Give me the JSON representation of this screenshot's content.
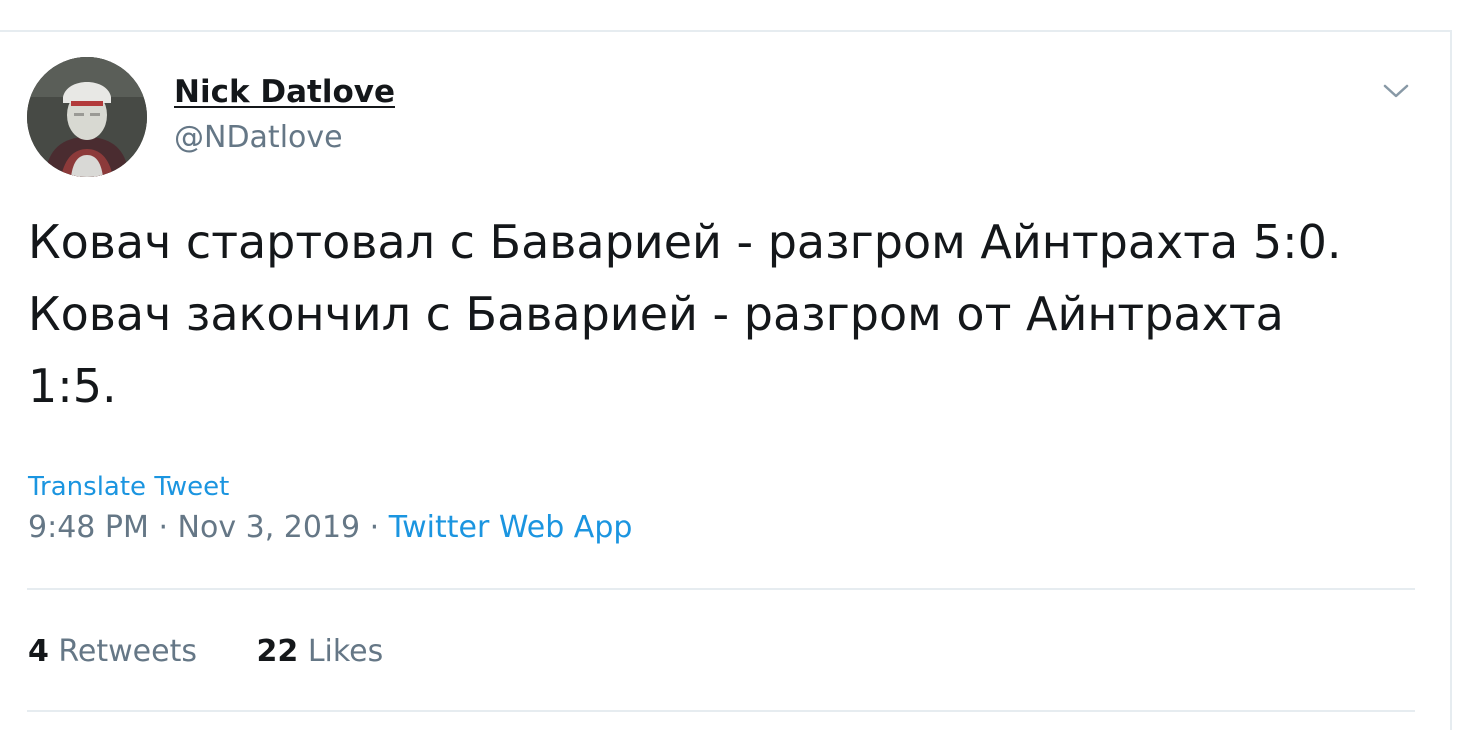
{
  "tweet": {
    "author": {
      "display_name": "Nick Datlove",
      "handle": "@NDatlove"
    },
    "text_lines": [
      "Ковач стартовал с Баварией - разгром Айнтрахта 5:0.",
      "Ковач закончил с Баварией - разгром от Айнтрахта",
      "1:5."
    ],
    "translate_label": "Translate Tweet",
    "time": "9:48 PM",
    "separator": "·",
    "date": "Nov 3, 2019",
    "source": "Twitter Web App",
    "stats": {
      "retweets_count": "4",
      "retweets_label": "Retweets",
      "likes_count": "22",
      "likes_label": "Likes"
    },
    "icons": {
      "more": "chevron-down-icon",
      "avatar": "profile-photo"
    }
  },
  "colors": {
    "text_primary": "#14171a",
    "text_secondary": "#657786",
    "link": "#1b95e0",
    "divider": "#e6ecf0"
  }
}
